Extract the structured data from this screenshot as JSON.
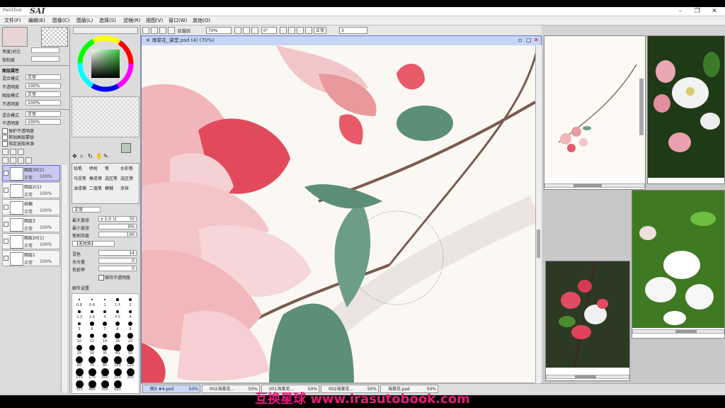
{
  "app": {
    "logo_text": "PaintTool",
    "name": "SAI",
    "window_controls": {
      "minimize": "–",
      "restore": "❐",
      "close": "✕"
    }
  },
  "menu": [
    "文件(F)",
    "编辑(E)",
    "图像(C)",
    "图层(L)",
    "选择(S)",
    "滤镜(R)",
    "视图(V)",
    "窗口(W)",
    "其他(O)"
  ],
  "left_panel": {
    "brightness_label": "亮度/对比",
    "saturation_label": "饱和度",
    "layer_props_title": "图层属性",
    "blend_label": "混合模式",
    "blend_value": "正常",
    "opacity_label": "不透明度",
    "opacity_value": "100%",
    "layer_mode_label": "图层模式",
    "layer_mode_value": "正常",
    "opacity2_label": "不透明度",
    "opacity2_value": "100%",
    "protect_label": "保护不透明度",
    "clip_label": "剪贴图层蒙版",
    "select_label": "指定选取来源",
    "layers": [
      {
        "name": "图层30(1)",
        "mode": "正常",
        "opacity": "100%"
      },
      {
        "name": "图层2(1)",
        "mode": "正常",
        "opacity": "100%"
      },
      {
        "name": "线稿",
        "mode": "正常",
        "opacity": "100%"
      },
      {
        "name": "图层3",
        "mode": "正常",
        "opacity": "100%"
      },
      {
        "name": "图层20(1)",
        "mode": "正常",
        "opacity": "100%"
      },
      {
        "name": "图层1",
        "mode": "正常",
        "opacity": "100%"
      }
    ]
  },
  "tool_panel": {
    "tools": [
      "铅笔",
      "喷枪",
      "笔",
      "水彩笔",
      "马克笔",
      "橡皮擦",
      "选区笔",
      "选区擦",
      "油漆桶",
      "二值笔",
      "模糊",
      "涂抹"
    ],
    "mode_label": "正常",
    "size_label": "最大直径",
    "size_value": "x 1.0",
    "size_num": "70",
    "min_size_label": "最小直径",
    "min_size_value": "0%",
    "density_label": "笔刷浓度",
    "density_value": "100",
    "texture_label": "【无材质】",
    "blend_label": "混色",
    "blend_value": "14",
    "water_label": "水分量",
    "water_value": "0",
    "keep_label": "色延伸",
    "keep_value": "0",
    "keep_opacity_label": "维持不透明度",
    "quality_label": "细节设置",
    "brush_sizes": [
      "0.8",
      "0.8",
      "1",
      "1.5",
      "2",
      "2.3",
      "2.6",
      "3",
      "3.5",
      "4",
      "5",
      "6",
      "7",
      "8",
      "9",
      "10",
      "12",
      "14",
      "16",
      "20",
      "25",
      "30",
      "35",
      "40",
      "50",
      "60",
      "70",
      "80",
      "100",
      "120",
      "150",
      "170",
      "200",
      "250",
      "300",
      "350",
      "400",
      "500",
      "600"
    ]
  },
  "canvas_toolbar": {
    "zoom": "70%",
    "angle": "0°",
    "normal_label": "正常",
    "snap_label": "抗锯齿",
    "stab_value": "3"
  },
  "canvas": {
    "title": "※ 海棠花_课堂.psd (4) (70%)"
  },
  "taskbar": [
    {
      "name": "图3 #4.psd",
      "zoom": "50%"
    },
    {
      "name": "002海棠花...",
      "zoom": "50%"
    },
    {
      "name": "001海棠花...",
      "zoom": "50%"
    },
    {
      "name": "002海棠花...",
      "zoom": "50%"
    },
    {
      "name": "海棠花.psd",
      "zoom": "50%"
    }
  ],
  "watermark": "互换星球 www.irasutobook.com",
  "colors": {
    "accent_window": "#5a7fd0",
    "selected_layer": "#c8c8f0",
    "watermark": "#e6197a"
  }
}
